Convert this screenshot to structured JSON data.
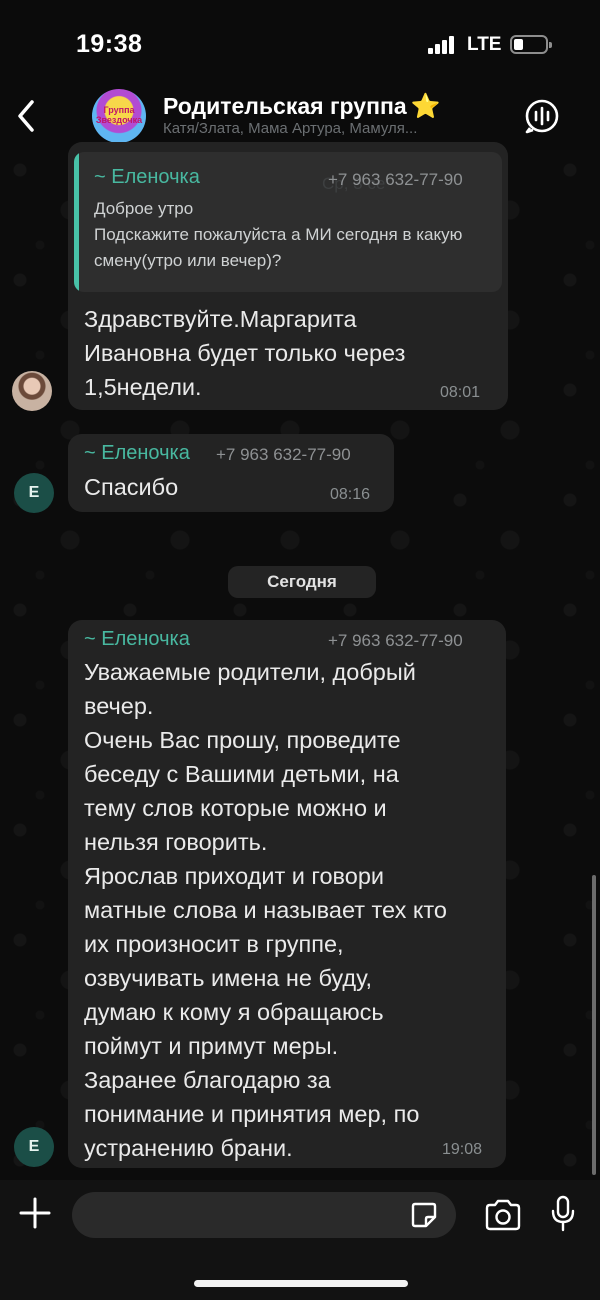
{
  "status_bar": {
    "time": "19:38",
    "network": "LTE"
  },
  "header": {
    "back_icon": "chevron-left-icon",
    "avatar_text": "Группа Звездочка",
    "title": "Родительская группа",
    "title_emoji": "⭐",
    "subtitle": "Катя/Злата, Мама Артура, Мамуля...",
    "call_icon": "voice-call-icon"
  },
  "messages": [
    {
      "quote": {
        "sender": "~ Еленочка",
        "phone": "+7 963 632-77-90",
        "date": "Ср, 3 се",
        "text": "Доброе утро\nПодскажите пожалуйста а МИ сегодня в какую смену(утро или вечер)?"
      },
      "text": "Здравствуйте.Маргарита\nИвановна будет только через\n1,5недели.",
      "time": "08:01"
    },
    {
      "sender": "~ Еленочка",
      "phone": "+7 963 632-77-90",
      "text": "Спасибо",
      "time": "08:16",
      "avatar_letter": "Е"
    },
    {
      "sender": "~ Еленочка",
      "phone": "+7 963 632-77-90",
      "text": "Уважаемые родители, добрый\nвечер.\nОчень Вас прошу, проведите\nбеседу с Вашими детьми, на\nтему слов которые можно и\nнельзя говорить.\nЯрослав приходит и говори\nматные слова и называет тех кто\nих произносит в группе,\nозвучивать имена не буду,\nдумаю к кому я обращаюсь\nпоймут и примут меры.\nЗаранее благодарю за\nпонимание и принятия мер, по\nустранению брани.",
      "time": "19:08",
      "avatar_letter": "Е"
    }
  ],
  "date_separator": "Сегодня",
  "input_bar": {
    "placeholder": "",
    "plus_icon": "plus-icon",
    "sticker_icon": "sticker-icon",
    "camera_icon": "camera-icon",
    "mic_icon": "microphone-icon"
  }
}
